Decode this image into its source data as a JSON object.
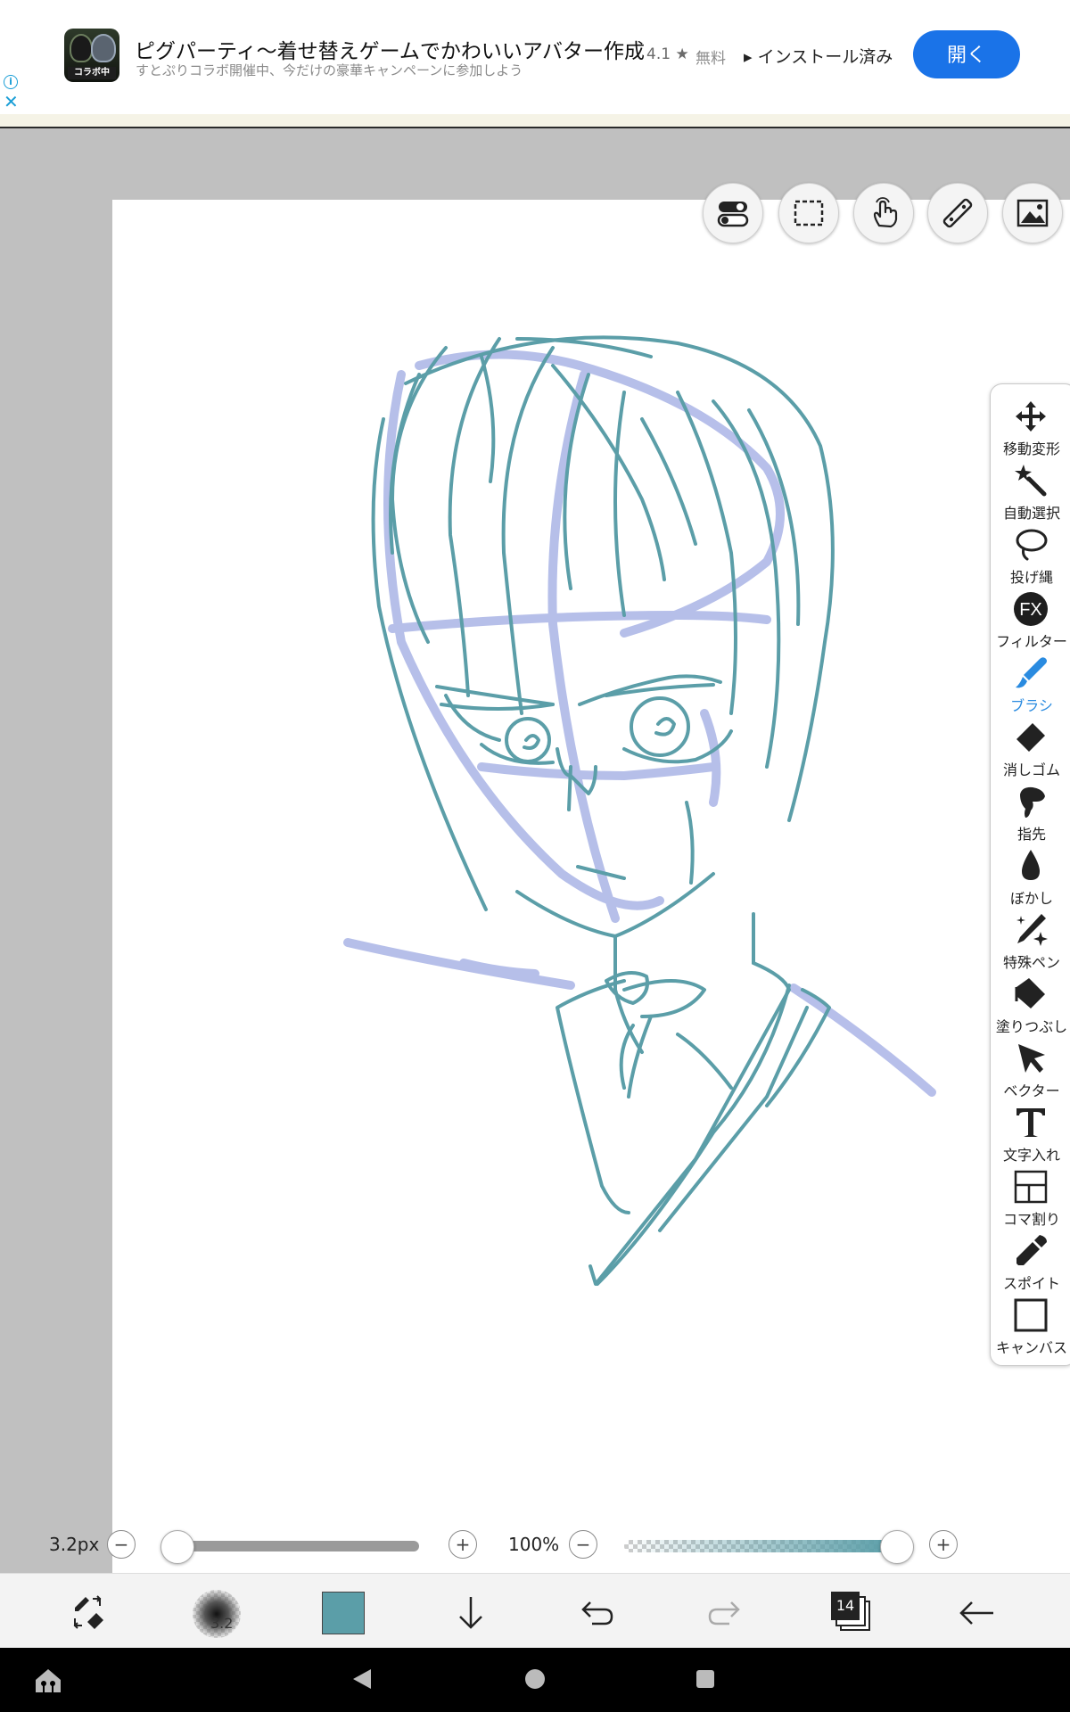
{
  "ad": {
    "app_icon_tag": "コラボ中",
    "title": "ピグパーティ〜着せ替えゲームでかわいいアバター作成",
    "subtitle": "すとぷりコラボ開催中、今だけの豪華キャンペーンに参加しよう",
    "rating": "4.1 ★",
    "price": "無料",
    "installed": "インストール済み",
    "open_button": "開く",
    "info_icon": "i",
    "close_icon": "✕"
  },
  "tools": [
    {
      "label": "移動変形",
      "icon": "move-icon",
      "active": false
    },
    {
      "label": "自動選択",
      "icon": "magic-wand-icon",
      "active": false
    },
    {
      "label": "投げ縄",
      "icon": "lasso-icon",
      "active": false
    },
    {
      "label": "フィルター",
      "icon": "fx-filter-icon",
      "active": false
    },
    {
      "label": "ブラシ",
      "icon": "brush-icon",
      "active": true
    },
    {
      "label": "消しゴム",
      "icon": "eraser-icon",
      "active": false
    },
    {
      "label": "指先",
      "icon": "smudge-finger-icon",
      "active": false
    },
    {
      "label": "ぼかし",
      "icon": "blur-drop-icon",
      "active": false
    },
    {
      "label": "特殊ペン",
      "icon": "special-pen-icon",
      "active": false
    },
    {
      "label": "塗りつぶし",
      "icon": "fill-bucket-icon",
      "active": false
    },
    {
      "label": "ベクター",
      "icon": "vector-arrow-icon",
      "active": false
    },
    {
      "label": "文字入れ",
      "icon": "text-icon",
      "active": false
    },
    {
      "label": "コマ割り",
      "icon": "panel-split-icon",
      "active": false
    },
    {
      "label": "スポイト",
      "icon": "eyedropper-icon",
      "active": false
    },
    {
      "label": "キャンバス",
      "icon": "canvas-icon",
      "active": false
    }
  ],
  "fx_label": "FX",
  "sliders": {
    "brush_size_label": "3.2px",
    "brush_size_fraction": 0.0,
    "opacity_label": "100%",
    "opacity_fraction": 1.0,
    "minus": "−",
    "plus": "+"
  },
  "bottom": {
    "brush_size_badge": "3.2",
    "layer_count": "14",
    "current_color": "#5b9ea8"
  },
  "colors": {
    "sketch_line": "#5b9ea8",
    "guide_line": "#aab4e6",
    "accent": "#2a8be0",
    "ad_button": "#1a73e8"
  }
}
